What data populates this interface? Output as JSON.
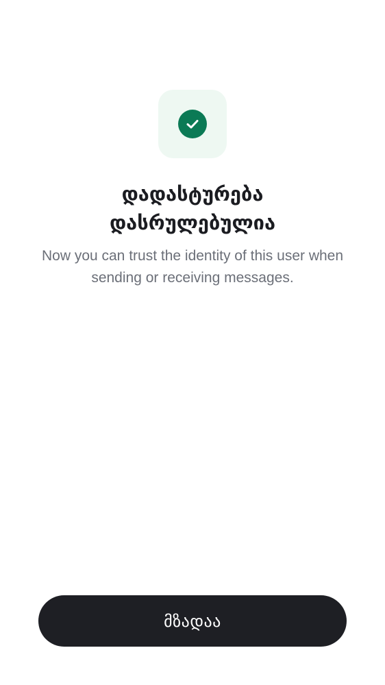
{
  "status_icon": {
    "name": "check-circle-icon",
    "tile_color": "#eef8f2",
    "circle_color": "#0b7a55"
  },
  "title": {
    "line1": "დადასტურება",
    "line2": "დასრულებულია"
  },
  "description": {
    "line1": "Now you can trust the identity of this user when",
    "line2": "sending or receiving messages."
  },
  "primary_button": {
    "label": "მზადაა",
    "color": "#1e1f24"
  }
}
